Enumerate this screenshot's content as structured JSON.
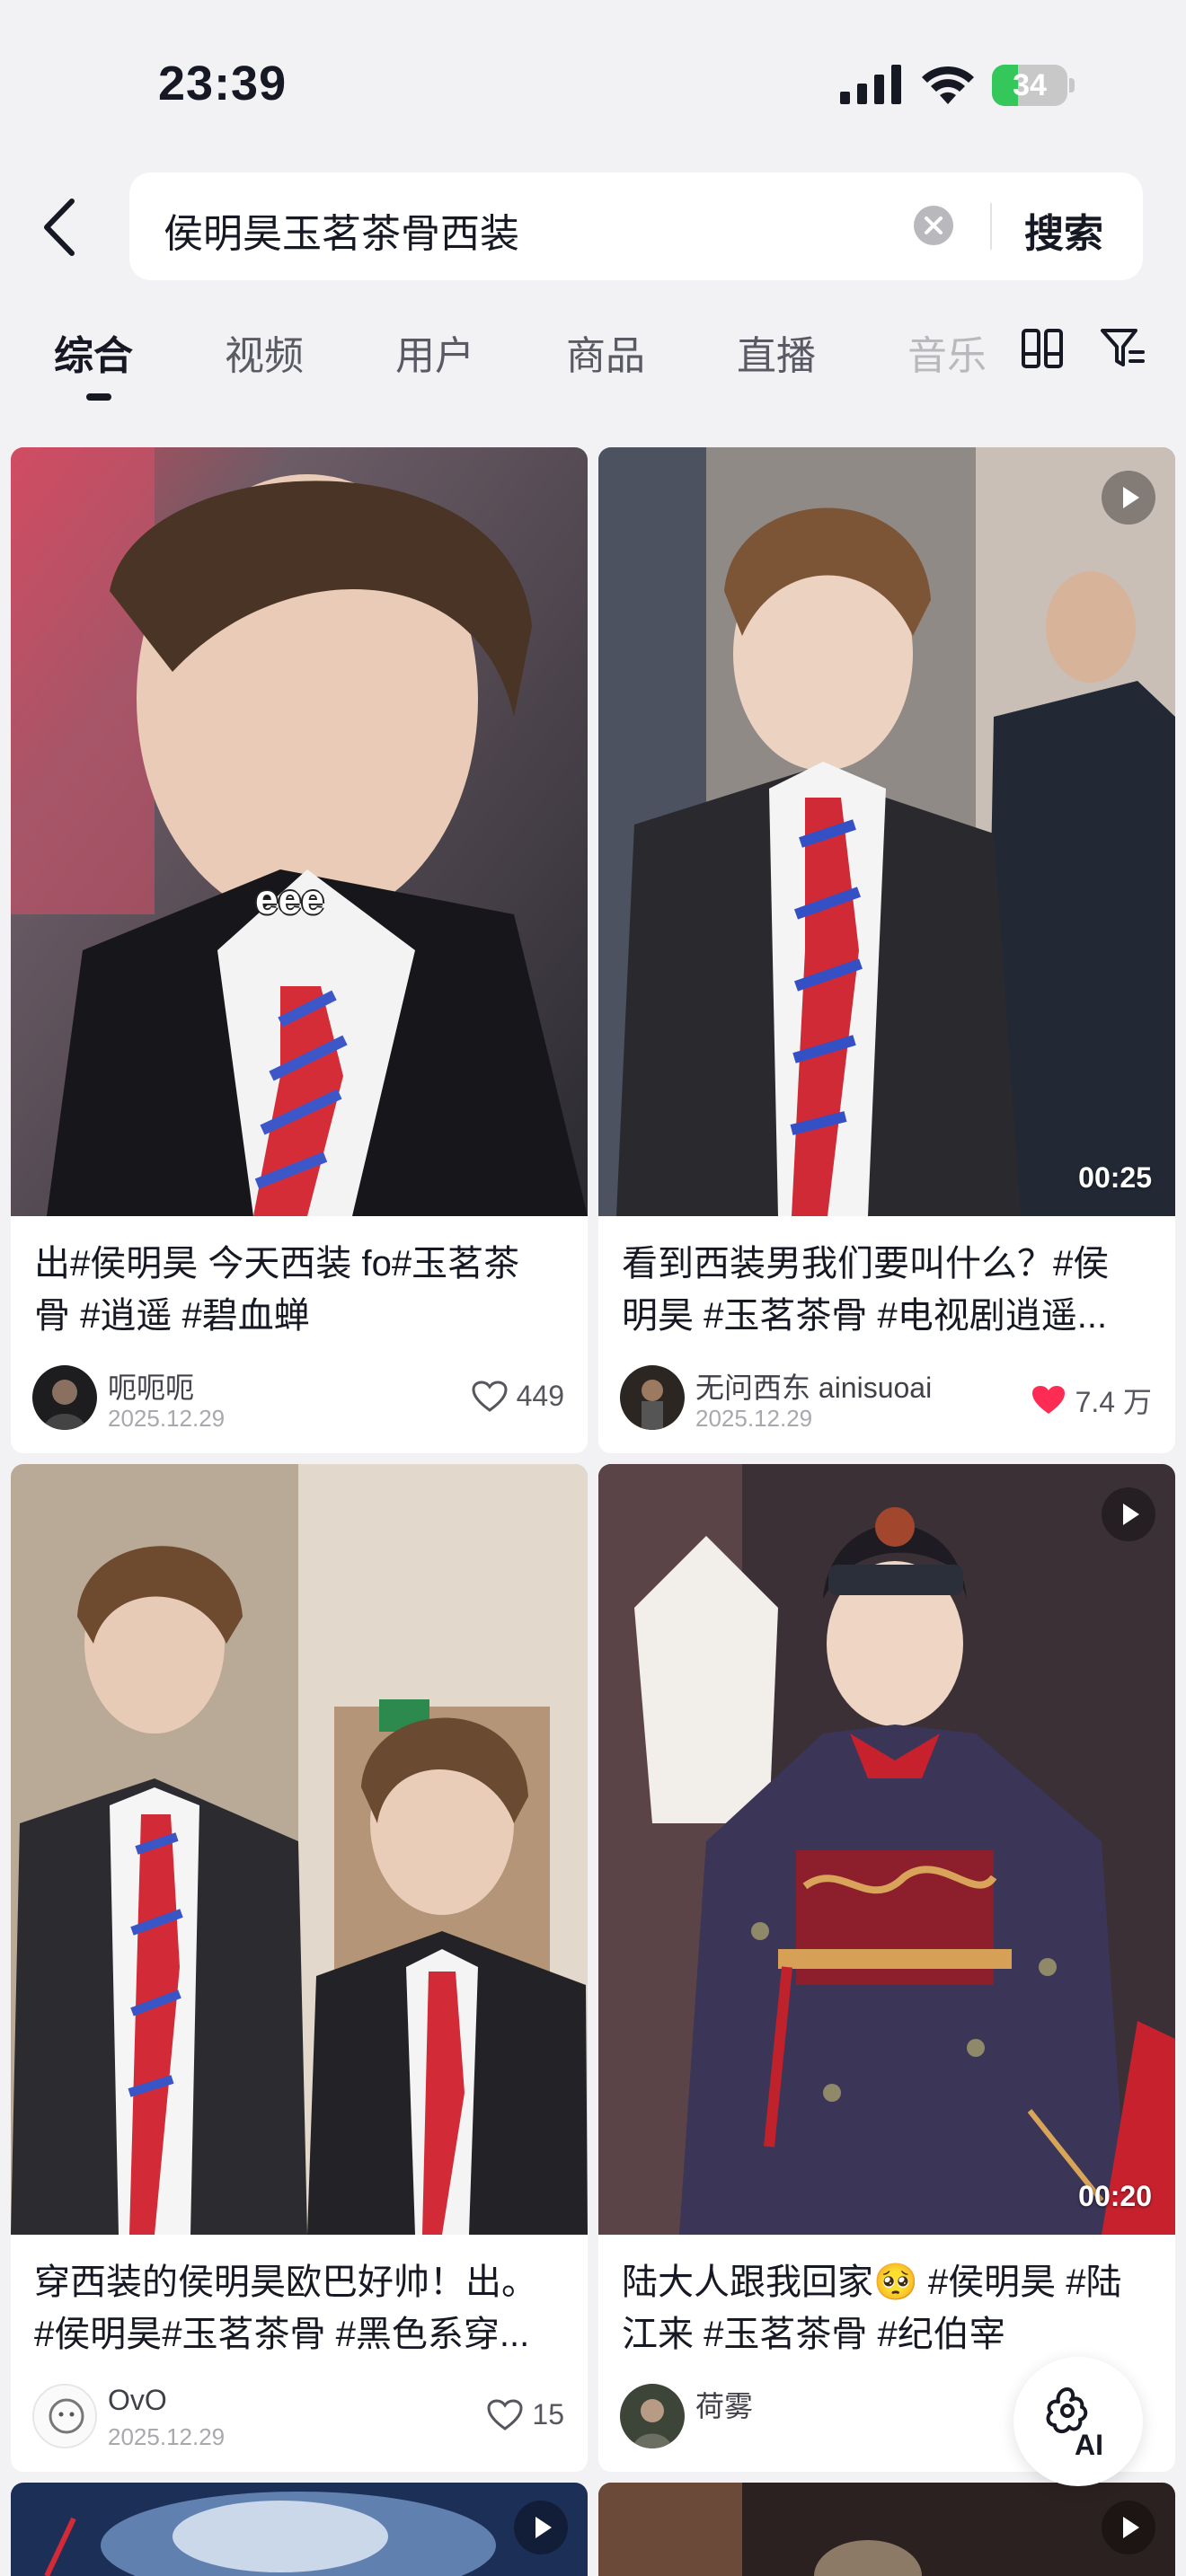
{
  "status_bar": {
    "time": "23:39",
    "battery_level": "34"
  },
  "search": {
    "query": "侯明昊玉茗茶骨西装",
    "submit_label": "搜索"
  },
  "tabs": [
    {
      "label": "综合",
      "active": true
    },
    {
      "label": "视频",
      "active": false
    },
    {
      "label": "用户",
      "active": false
    },
    {
      "label": "商品",
      "active": false
    },
    {
      "label": "直播",
      "active": false
    },
    {
      "label": "音乐",
      "active": false
    }
  ],
  "results": [
    {
      "overlay_text": "eee",
      "title_line1": "出#侯明昊 今天西装 fo#玉茗茶",
      "title_line2": "骨 #逍遥 #碧血蝉",
      "author": "呃呃呃",
      "date": "2025.12.29",
      "likes": "449",
      "liked": false,
      "duration": ""
    },
    {
      "overlay_text": "",
      "title_line1": "看到西装男我们要叫什么？#侯",
      "title_line2": "明昊 #玉茗茶骨 #电视剧逍遥...",
      "author": "无问西东 ainisuoai",
      "date": "2025.12.29",
      "likes": "7.4 万",
      "liked": true,
      "duration": "00:25"
    },
    {
      "overlay_text": "",
      "title_line1": "穿西装的侯明昊欧巴好帅！出。",
      "title_line2": "#侯明昊#玉茗茶骨 #黑色系穿...",
      "author": "OvO",
      "date": "2025.12.29",
      "likes": "15",
      "liked": false,
      "duration": ""
    },
    {
      "overlay_text": "",
      "title_line1": "陆大人跟我回家🥺 #侯明昊 #陆",
      "title_line2": "江来 #玉茗茶骨 #纪伯宰",
      "author": "荷雾",
      "date": "",
      "likes": "",
      "liked": false,
      "duration": "00:20"
    }
  ],
  "ai_button": {
    "label": "AI"
  },
  "colors": {
    "accent_like": "#fe2c55",
    "battery_green": "#34c759",
    "background": "#f2f2f4",
    "text_primary": "#161823"
  },
  "icons": [
    "back-arrow-icon",
    "clear-icon",
    "layout-icon",
    "filter-icon",
    "play-icon",
    "heart-icon",
    "ai-assistant-icon"
  ]
}
